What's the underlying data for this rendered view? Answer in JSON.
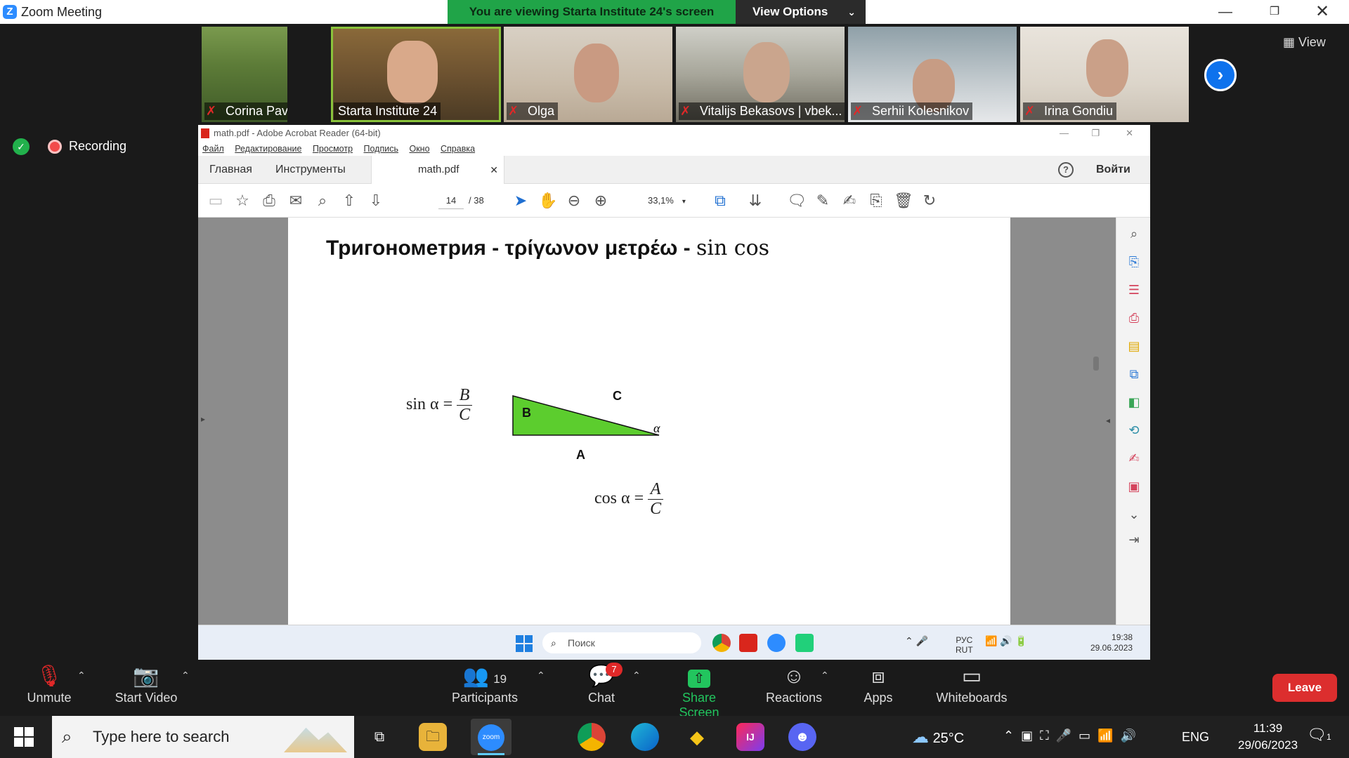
{
  "zoom": {
    "window_title": "Zoom Meeting",
    "share_banner": "You are viewing Starta Institute 24's screen",
    "view_options": "View Options",
    "view_label": "View",
    "recording": "Recording",
    "participants_strip": [
      {
        "name": "Corina Pavliuc"
      },
      {
        "name": "Starta Institute 24"
      },
      {
        "name": "Olga"
      },
      {
        "name": "Vitalijs Bekasovs | vbek..."
      },
      {
        "name": "Serhii Kolesnikov"
      },
      {
        "name": "Irina Gondiu"
      }
    ],
    "controls": {
      "unmute": "Unmute",
      "start_video": "Start Video",
      "participants": "Participants",
      "participants_count": "19",
      "chat": "Chat",
      "chat_badge": "7",
      "share_screen": "Share Screen",
      "reactions": "Reactions",
      "apps": "Apps",
      "whiteboards": "Whiteboards",
      "leave": "Leave"
    }
  },
  "acrobat": {
    "title": "math.pdf - Adobe Acrobat Reader (64-bit)",
    "menu": [
      "Файл",
      "Редактирование",
      "Просмотр",
      "Подпись",
      "Окно",
      "Справка"
    ],
    "tabs": {
      "home": "Главная",
      "tools": "Инструменты",
      "doc": "math.pdf"
    },
    "login": "Войти",
    "page_current": "14",
    "page_total": "/ 38",
    "zoom": "33,1%",
    "page": {
      "heading_bold": "Тригонометрия - τρίγωνον μετρέω - ",
      "heading_serif": "sin cos",
      "sin_lhs": "sin α =",
      "sin_num": "B",
      "sin_den": "C",
      "cos_lhs": "cos α =",
      "cos_num": "A",
      "cos_den": "C",
      "tri_B": "B",
      "tri_C": "C",
      "tri_A": "A",
      "tri_alpha": "α",
      "triangle_color": "#5ccd2e"
    },
    "inner_taskbar": {
      "search": "Поиск",
      "lang1": "РУС",
      "lang2": "RUT",
      "time": "19:38",
      "date": "29.06.2023"
    }
  },
  "windows": {
    "search_placeholder": "Type here to search",
    "weather": "25°C",
    "lang": "ENG",
    "time": "11:39",
    "date": "29/06/2023",
    "notifications": "1"
  }
}
